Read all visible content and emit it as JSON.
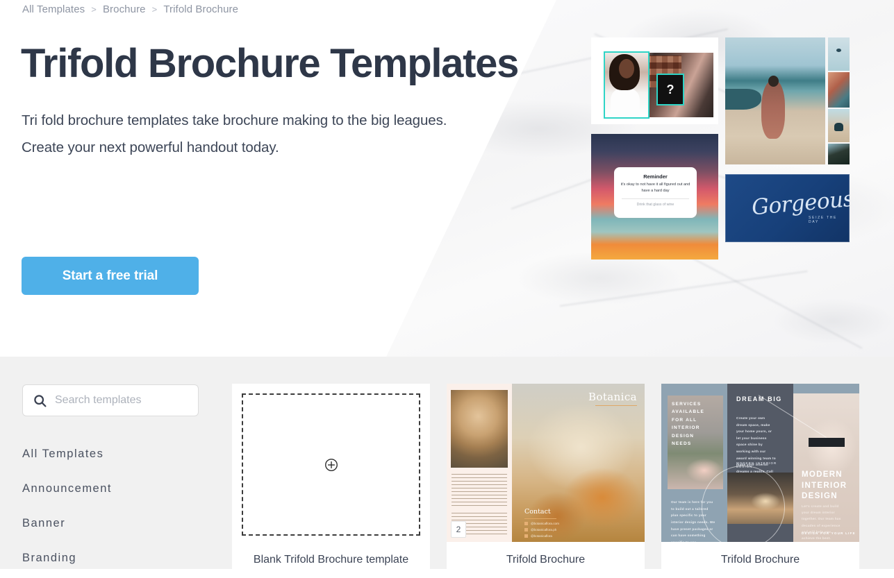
{
  "breadcrumb": {
    "items": [
      "All Templates",
      "Brochure",
      "Trifold Brochure"
    ],
    "separator": ">"
  },
  "hero": {
    "title": "Trifold Brochure Templates",
    "subtitle_line1": "Tri fold brochure templates take brochure making to the big leagues.",
    "subtitle_line2": "Create your next powerful handout today.",
    "cta_label": "Start a free trial",
    "cta_color": "#4fb0e8",
    "title_color": "#2e3748",
    "collage": {
      "makeup_tile": {
        "name": "makeup-tutorial-thumbnail",
        "badge": "?"
      },
      "sunset_tile": {
        "name": "reminder-quote-post",
        "card_title": "Reminder",
        "card_body": "it's okay to not have it all figured out and have a hard day",
        "card_footer": "Drink that glass of wine"
      },
      "beach_tile": {
        "name": "beach-photo"
      },
      "strip_tiles": [
        "sea-strip",
        "sunset-hands-strip",
        "shore-strip",
        "palm-strip"
      ],
      "gorgeous_tile": {
        "name": "gorgeous-card",
        "script": "Gorgeous",
        "subtitle": "SEIZE THE DAY"
      }
    }
  },
  "sidebar": {
    "search": {
      "placeholder": "Search templates",
      "value": "",
      "icon": "search-icon"
    },
    "items": [
      {
        "label": "All Templates"
      },
      {
        "label": "Announcement"
      },
      {
        "label": "Banner"
      },
      {
        "label": "Branding"
      }
    ]
  },
  "templates": {
    "cards": [
      {
        "label": "Blank Trifold Brochure template",
        "type": "blank",
        "icon": "plus-circle-icon"
      },
      {
        "label": "Trifold Brochure",
        "type": "botanica",
        "page_badge": "2",
        "brand": "Botanica",
        "contact_heading": "Contact",
        "contact_rows": [
          "@botanicaflora.com",
          "@botanicaflora.ph",
          "@botanicaflora"
        ]
      },
      {
        "label": "Trifold Brochure",
        "type": "interior",
        "panel_left_heading": "SERVICES AVAILABLE FOR ALL INTERIOR DESIGN NEEDS",
        "panel_left_body": "Our team is here for you to build out a tailored plan specific to your interior design needs. We have preset packages or can have something specific to you.",
        "panel_mid_heading": "DREAM BIG",
        "panel_mid_body": "Create your own dream space, make your home yours, or let your business space shine by working with our award winning team to make your interior dreams a reality. Call or email to set up a free consultation today.",
        "panel_mid_tag": "MODERN INTERIOR DESIGN",
        "panel_right_heading": "MODERN INTERIOR DESIGN",
        "panel_right_body": "Let's create and build your dream interior together. Our team has decades of experience and will help you achieve the best.",
        "panel_right_tag": "DESIGN FOR YOUR LIFE"
      }
    ]
  },
  "colors": {
    "page_background": "#ffffff",
    "lower_background": "#f1f1f1",
    "accent": "#4fb0e8",
    "muted_text": "#8e95a3"
  }
}
